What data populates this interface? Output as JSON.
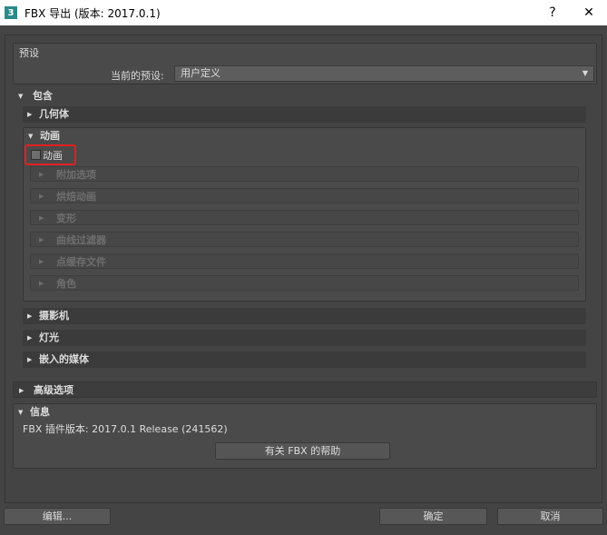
{
  "titlebar": {
    "app_icon": "3",
    "title": "FBX 导出 (版本: 2017.0.1)",
    "help": "?",
    "close": "✕"
  },
  "preset": {
    "group_label": "预设",
    "row_label": "当前的预设:",
    "value": "用户定义"
  },
  "include": {
    "label": "包含",
    "geometry": "几何体",
    "animation": {
      "label": "动画",
      "checkbox_label": "动画",
      "checked": false,
      "items": [
        "附加选项",
        "烘焙动画",
        "变形",
        "曲线过滤器",
        "点缓存文件",
        "角色"
      ]
    },
    "camera": "摄影机",
    "lights": "灯光",
    "embed_media": "嵌入的媒体"
  },
  "advanced": {
    "label": "高级选项"
  },
  "info": {
    "label": "信息",
    "version_text": "FBX 插件版本: 2017.0.1 Release (241562)",
    "help_button": "有关 FBX 的帮助"
  },
  "buttons": {
    "edit": "编辑...",
    "ok": "确定",
    "cancel": "取消"
  },
  "colors": {
    "background": "#444444",
    "highlight": "#e02020",
    "titlebar": "#ffffff"
  }
}
